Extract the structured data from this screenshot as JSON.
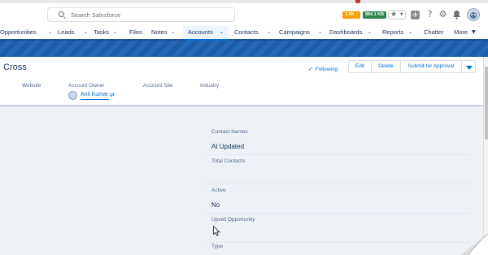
{
  "search": {
    "placeholder": "Search Salesforce"
  },
  "header": {
    "badge_orange": "3.8K ↑",
    "badge_green": "984.1 KB",
    "icons": [
      "star-icon",
      "plus-icon",
      "help-icon",
      "gear-icon",
      "bell-icon",
      "avatar"
    ]
  },
  "nav": {
    "items": [
      {
        "label": "Opportunities"
      },
      {
        "label": "Leads"
      },
      {
        "label": "Tasks"
      },
      {
        "label": "Files"
      },
      {
        "label": "Notes"
      },
      {
        "label": "Accounts"
      },
      {
        "label": "Contacts"
      },
      {
        "label": "Campaigns"
      },
      {
        "label": "Dashboards"
      },
      {
        "label": "Reports"
      },
      {
        "label": "Chatter"
      },
      {
        "label": "More"
      }
    ],
    "active": "Accounts"
  },
  "record": {
    "name": "Cross",
    "following_label": "Following",
    "edit_label": "Edit",
    "delete_label": "Delete",
    "submit_label": "Submit for Approval",
    "highlights": {
      "website_label": "Website",
      "owner_label": "Account Owner",
      "site_label": "Account Site",
      "industry_label": "Industry",
      "owner_name": "Anil Kumar"
    }
  },
  "details": {
    "contact_names_label": "Contact Names",
    "contact_names_value": "At Updated",
    "total_contacts_label": "Total Contacts",
    "active_label": "Active",
    "active_value": "No",
    "upsell_label": "Upsell Opportunity",
    "type_label": "Type"
  },
  "colors": {
    "brand_blue": "#0070d2",
    "nav_band": "#1c5ea8",
    "badge_orange": "#f59f00",
    "badge_green": "#2e844a"
  }
}
